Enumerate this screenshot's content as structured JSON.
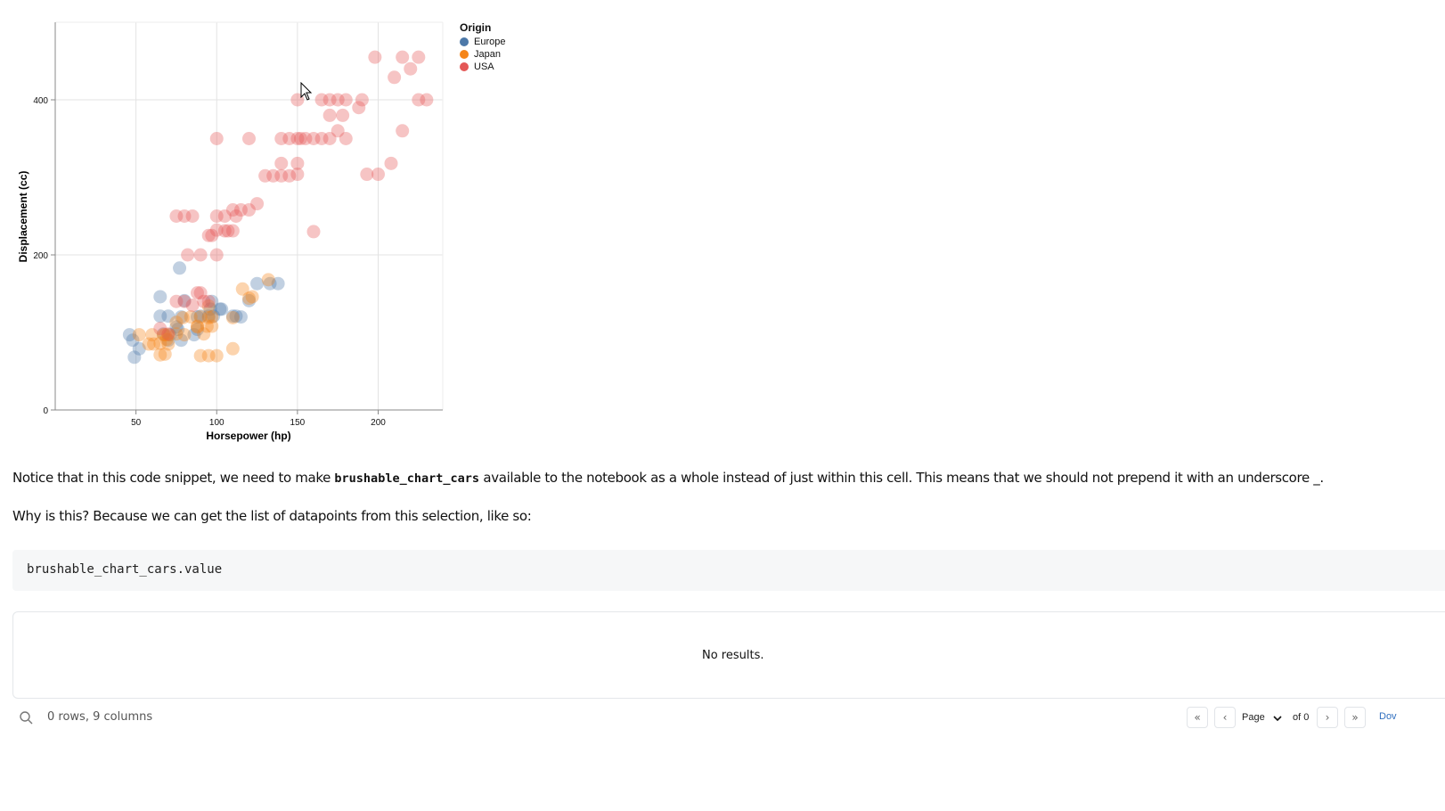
{
  "chart_data": {
    "type": "scatter",
    "xlabel": "Horsepower (hp)",
    "ylabel": "Displacement (cc)",
    "xlim": [
      0,
      240
    ],
    "ylim": [
      0,
      500
    ],
    "x_ticks": [
      50,
      100,
      150,
      200
    ],
    "y_ticks": [
      0,
      200,
      400
    ],
    "grid": true,
    "legend": {
      "title": "Origin",
      "placement": "top-right outside"
    },
    "series": [
      {
        "name": "Europe",
        "color": "#4c78a8",
        "points": [
          [
            46,
            97
          ],
          [
            48,
            90
          ],
          [
            49,
            68
          ],
          [
            52,
            79
          ],
          [
            65,
            121
          ],
          [
            65,
            146
          ],
          [
            67,
            98
          ],
          [
            70,
            121
          ],
          [
            70,
            90
          ],
          [
            71,
            97
          ],
          [
            75,
            107
          ],
          [
            76,
            104
          ],
          [
            78,
            120
          ],
          [
            78,
            90
          ],
          [
            80,
            141
          ],
          [
            86,
            97
          ],
          [
            88,
            120
          ],
          [
            88,
            104
          ],
          [
            90,
            121
          ],
          [
            95,
            121
          ],
          [
            96,
            130
          ],
          [
            97,
            140
          ],
          [
            98,
            121
          ],
          [
            102,
            130
          ],
          [
            103,
            130
          ],
          [
            110,
            121
          ],
          [
            112,
            121
          ],
          [
            115,
            120
          ],
          [
            120,
            141
          ],
          [
            125,
            163
          ],
          [
            133,
            163
          ],
          [
            138,
            163
          ],
          [
            77,
            183
          ]
        ]
      },
      {
        "name": "Japan",
        "color": "#f58518",
        "points": [
          [
            52,
            97
          ],
          [
            58,
            85
          ],
          [
            60,
            97
          ],
          [
            61,
            85
          ],
          [
            65,
            71
          ],
          [
            65,
            86
          ],
          [
            67,
            97
          ],
          [
            68,
            72
          ],
          [
            68,
            97
          ],
          [
            69,
            91
          ],
          [
            70,
            97
          ],
          [
            70,
            85
          ],
          [
            75,
            98
          ],
          [
            75,
            113
          ],
          [
            79,
            119
          ],
          [
            80,
            97
          ],
          [
            84,
            120
          ],
          [
            88,
            107
          ],
          [
            88,
            108
          ],
          [
            90,
            120
          ],
          [
            92,
            98
          ],
          [
            94,
            108
          ],
          [
            95,
            134
          ],
          [
            95,
            119
          ],
          [
            97,
            120
          ],
          [
            97,
            108
          ],
          [
            110,
            119
          ],
          [
            116,
            156
          ],
          [
            120,
            144
          ],
          [
            122,
            146
          ],
          [
            132,
            168
          ],
          [
            90,
            70
          ],
          [
            95,
            70
          ],
          [
            100,
            70
          ],
          [
            110,
            79
          ]
        ]
      },
      {
        "name": "USA",
        "color": "#e45756",
        "points": [
          [
            65,
            105
          ],
          [
            70,
            98
          ],
          [
            75,
            140
          ],
          [
            80,
            140
          ],
          [
            85,
            135
          ],
          [
            88,
            151
          ],
          [
            90,
            151
          ],
          [
            92,
            140
          ],
          [
            95,
            140
          ],
          [
            95,
            225
          ],
          [
            97,
            225
          ],
          [
            100,
            250
          ],
          [
            100,
            232
          ],
          [
            100,
            200
          ],
          [
            105,
            250
          ],
          [
            105,
            231
          ],
          [
            107,
            231
          ],
          [
            110,
            258
          ],
          [
            110,
            231
          ],
          [
            112,
            250
          ],
          [
            115,
            258
          ],
          [
            120,
            258
          ],
          [
            125,
            266
          ],
          [
            130,
            302
          ],
          [
            135,
            302
          ],
          [
            140,
            302
          ],
          [
            140,
            318
          ],
          [
            145,
            302
          ],
          [
            150,
            318
          ],
          [
            150,
            304
          ],
          [
            150,
            350
          ],
          [
            152,
            350
          ],
          [
            155,
            350
          ],
          [
            160,
            350
          ],
          [
            165,
            350
          ],
          [
            165,
            400
          ],
          [
            170,
            350
          ],
          [
            170,
            400
          ],
          [
            175,
            400
          ],
          [
            175,
            360
          ],
          [
            180,
            350
          ],
          [
            180,
            400
          ],
          [
            190,
            400
          ],
          [
            198,
            455
          ],
          [
            210,
            429
          ],
          [
            215,
            455
          ],
          [
            220,
            440
          ],
          [
            225,
            400
          ],
          [
            230,
            400
          ],
          [
            85,
            250
          ],
          [
            80,
            250
          ],
          [
            75,
            250
          ],
          [
            90,
            200
          ],
          [
            82,
            200
          ],
          [
            100,
            350
          ],
          [
            120,
            350
          ],
          [
            140,
            350
          ],
          [
            160,
            230
          ],
          [
            193,
            304
          ],
          [
            200,
            304
          ],
          [
            208,
            318
          ],
          [
            215,
            360
          ],
          [
            225,
            455
          ],
          [
            150,
            400
          ],
          [
            170,
            380
          ],
          [
            178,
            380
          ],
          [
            188,
            390
          ],
          [
            145,
            350
          ]
        ]
      }
    ]
  },
  "text": {
    "note_before": "Notice that in this code snippet, we need to make ",
    "note_code": "brushable_chart_cars",
    "note_after": " available to the notebook as a whole instead of just within this cell. This means that we should not prepend it with an underscore _.",
    "question": "Why is this? Because we can get the list of datapoints from this selection, like so:",
    "code": "brushable_chart_cars.value",
    "no_results": "No results.",
    "rows_info": "0 rows, 9 columns",
    "page_label": "Page",
    "of_label": "of 0",
    "download_label": "Dov"
  },
  "icons": {
    "search": "search-icon",
    "first": "chevrons-left-icon",
    "prev": "chevron-left-icon",
    "next": "chevron-right-icon",
    "last": "chevrons-right-icon",
    "select": "chevron-down-icon",
    "cursor": "mouse-pointer-icon"
  }
}
